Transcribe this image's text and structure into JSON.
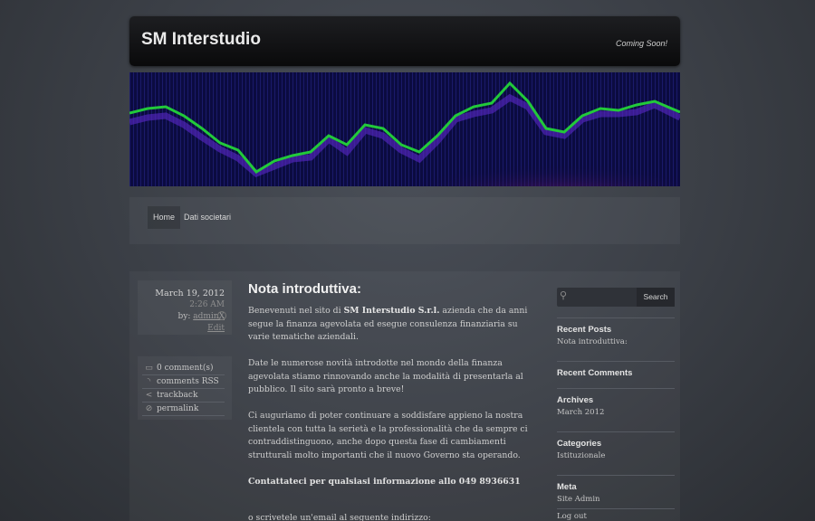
{
  "header": {
    "site_title": "SM Interstudio",
    "tagline": "Coming Soon!"
  },
  "nav": {
    "items": [
      {
        "label": "Home"
      },
      {
        "label": "Dati societari"
      }
    ]
  },
  "post_meta": {
    "date": "March 19, 2012",
    "time": "2:26 AM",
    "by_prefix": "by:",
    "author": "adminX",
    "edit": "Edit"
  },
  "post_actions": [
    {
      "label": "0 comment(s)",
      "icon": "comment-icon"
    },
    {
      "label": "comments RSS",
      "icon": "rss-icon"
    },
    {
      "label": "trackback",
      "icon": "trackback-icon"
    },
    {
      "label": "permalink",
      "icon": "link-icon"
    }
  ],
  "post": {
    "title": "Nota introduttiva:",
    "p1_a": "Benevenuti nel sito di ",
    "p1_bold": "SM Interstudio S.r.l.",
    "p1_b": " azienda che da anni segue la finanza agevolata ed esegue consulenza finanziaria su varie tematiche aziendali.",
    "p2": "Date le numerose novità introdotte nel mondo della finanza agevolata stiamo rinnovando anche la modalità di presentarla al pubblico. Il sito sarà pronto a breve!",
    "p3": "Ci auguriamo di poter continuare a soddisfare appieno la nostra clientela con tutta la serietà e la professionalità che da sempre ci contraddistinguono, anche dopo questa fase di cambiamenti strutturali molto importanti che il nuovo Governo sta operando.",
    "contact": "Contattateci per qualsiasi informazione allo 049 8936631",
    "email_line": "o scrivetele un'email al seguente indirizzo:"
  },
  "sidebar": {
    "search_placeholder": "",
    "search_button": "Search",
    "recent_posts_title": "Recent Posts",
    "recent_posts": [
      "Nota introduttiva:"
    ],
    "recent_comments_title": "Recent Comments",
    "archives_title": "Archives",
    "archives": [
      "March 2012"
    ],
    "categories_title": "Categories",
    "categories": [
      "Istituzionale"
    ],
    "meta_title": "Meta",
    "meta": [
      "Site Admin",
      "Log out"
    ]
  },
  "colors": {
    "banner_bg": "#0a0a3c",
    "banner_line_green": "#22c93a",
    "banner_line_purple": "#6a2bd0"
  }
}
